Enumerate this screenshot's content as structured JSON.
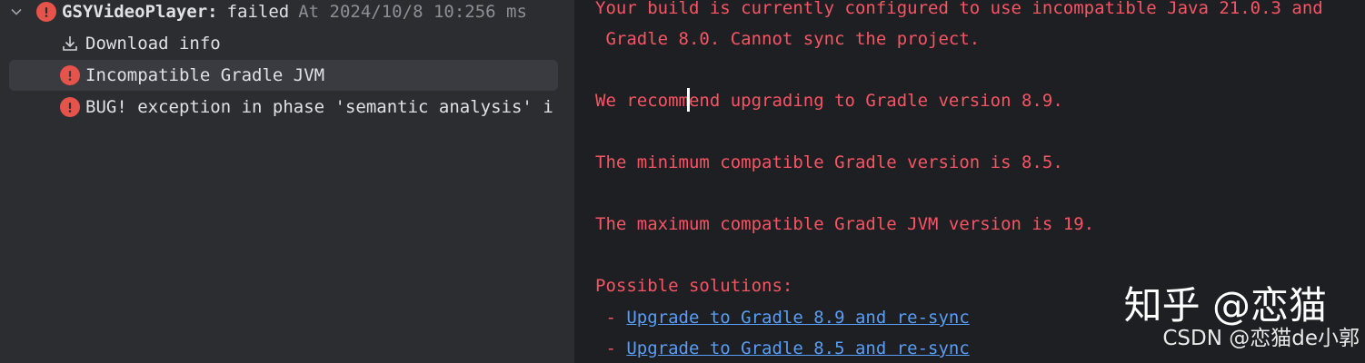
{
  "tree": {
    "root": {
      "name": "GSYVideoPlayer:",
      "status": "failed",
      "timestamp": "At 2024/10/8 10:",
      "duration": "256 ms",
      "icon": "error-icon",
      "expanded": true
    },
    "items": [
      {
        "label": "Download info",
        "icon": "download-icon",
        "selected": false
      },
      {
        "label": "Incompatible Gradle JVM",
        "icon": "error-icon",
        "selected": true
      },
      {
        "label": "BUG! exception in phase 'semantic analysis' i",
        "icon": "error-icon",
        "selected": false
      }
    ]
  },
  "output": {
    "lines": [
      "Your build is currently configured to use incompatible Java 21.0.3 and",
      " Gradle 8.0. Cannot sync the project.",
      "We recommend upgrading to Gradle version 8.9.",
      "The minimum compatible Gradle version is 8.5.",
      "The maximum compatible Gradle JVM version is 19.",
      "Possible solutions:"
    ],
    "solutions": [
      {
        "prefix": " - ",
        "link": "Upgrade to Gradle 8.9 and re-sync"
      },
      {
        "prefix": " - ",
        "link": "Upgrade to Gradle 8.5 and re-sync"
      }
    ]
  },
  "watermark": {
    "primary": "知乎 @恋猫",
    "secondary": "CSDN @恋猫de小郭"
  },
  "colors": {
    "error_text": "#f75464",
    "link": "#589df6",
    "error_icon": "#e5534b",
    "panel_left": "#2b2d30",
    "panel_right": "#1e1f22"
  }
}
